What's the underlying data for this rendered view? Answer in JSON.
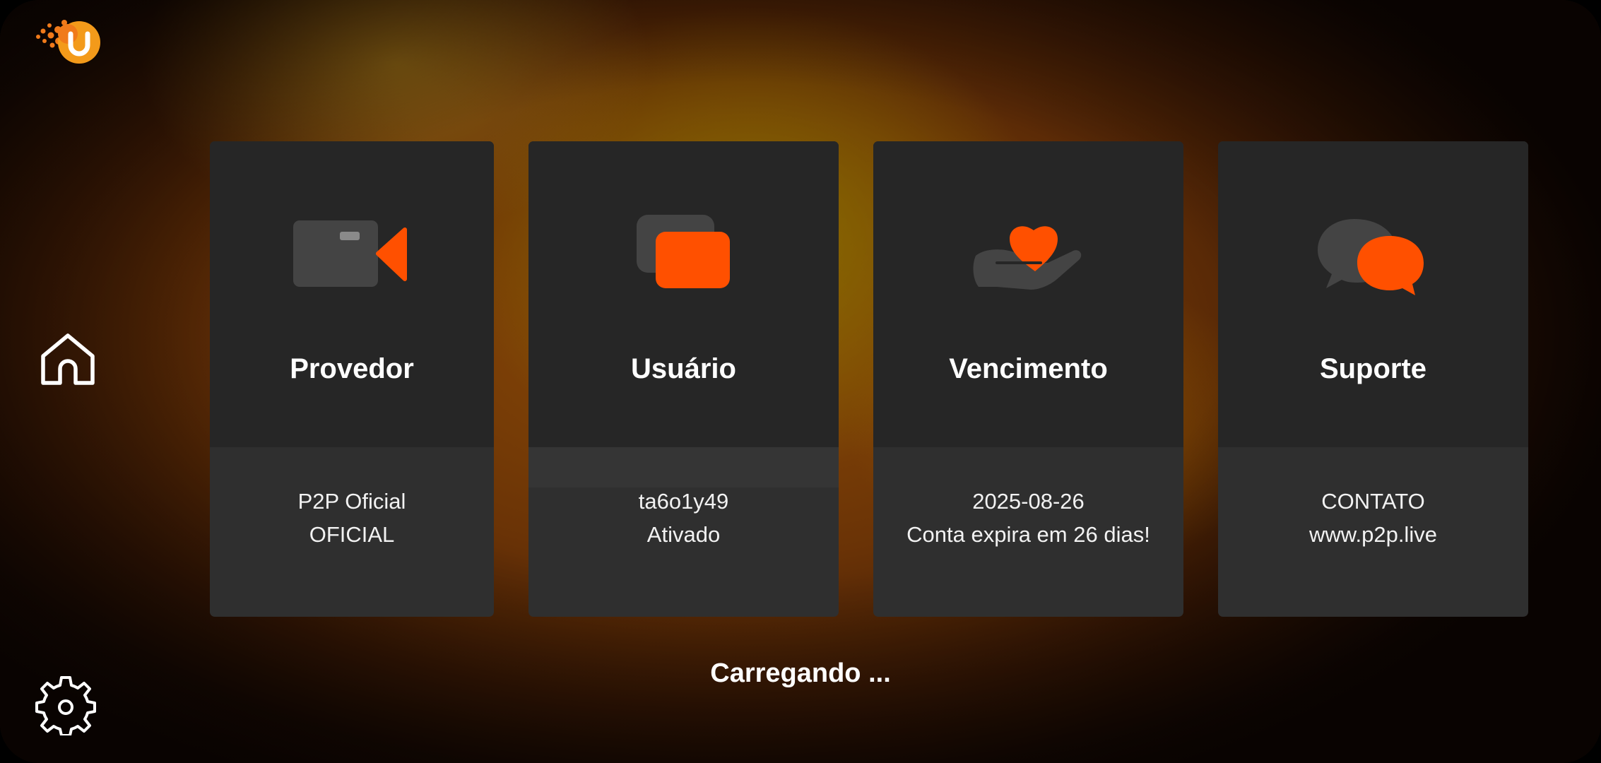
{
  "app": {
    "logo_icon": "brand-logo-icon",
    "accent_color": "#ff5000"
  },
  "nav": {
    "home_icon": "home-icon",
    "settings_icon": "gear-icon"
  },
  "cards": [
    {
      "title": "Provedor",
      "line1": "P2P Oficial",
      "line2": "OFICIAL",
      "icon": "video-camera-icon"
    },
    {
      "title": "Usuário",
      "line1": "ta6o1y49",
      "line2": "Ativado",
      "icon": "user-cards-icon"
    },
    {
      "title": "Vencimento",
      "line1": "2025-08-26",
      "line2": "Conta expira em 26 dias!",
      "icon": "heart-hand-icon"
    },
    {
      "title": "Suporte",
      "line1": "CONTATO",
      "line2": "www.p2p.live",
      "icon": "chat-bubbles-icon"
    }
  ],
  "status": "Carregando ..."
}
